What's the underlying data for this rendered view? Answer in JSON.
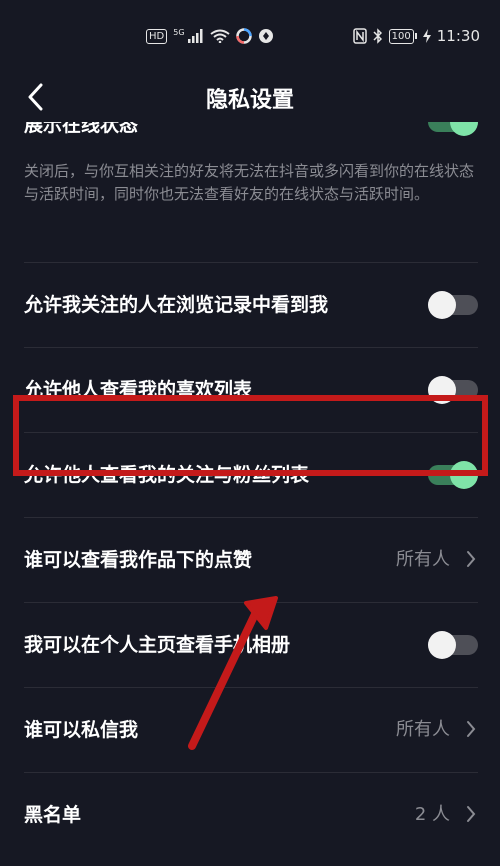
{
  "status_bar": {
    "hd": "HD",
    "signal_tag": "5G",
    "battery": "100",
    "time": "11:30"
  },
  "nav": {
    "title": "隐私设置"
  },
  "online_status": {
    "title": "展示在线状态",
    "description": "关闭后，与你互相关注的好友将无法在抖音或多闪看到你的在线状态与活跃时间，同时你也无法查看好友的在线状态与活跃时间。",
    "enabled": true
  },
  "settings": [
    {
      "label": "允许我关注的人在浏览记录中看到我",
      "type": "toggle",
      "enabled": false
    },
    {
      "label": "允许他人查看我的喜欢列表",
      "type": "toggle",
      "enabled": false
    },
    {
      "label": "允许他人查看我的关注与粉丝列表",
      "type": "toggle",
      "enabled": true
    },
    {
      "label": "谁可以查看我作品下的点赞",
      "type": "select",
      "value": "所有人"
    },
    {
      "label": "我可以在个人主页查看手机相册",
      "type": "toggle",
      "enabled": false
    },
    {
      "label": "谁可以私信我",
      "type": "select",
      "value": "所有人"
    },
    {
      "label": "黑名单",
      "type": "select",
      "value": "2 人"
    }
  ],
  "colors": {
    "background": "#161823",
    "toggle_on": "#7fe3a8",
    "annotation": "#c41a1a"
  }
}
